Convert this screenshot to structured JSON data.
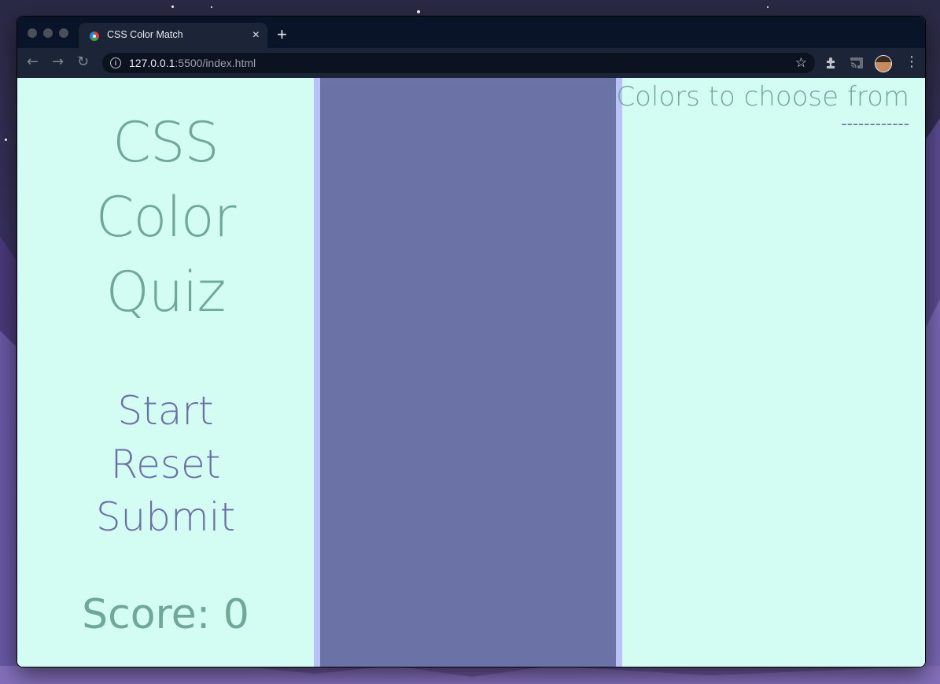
{
  "browser": {
    "tab_title": "CSS Color Match",
    "tab_close": "×",
    "new_tab": "+",
    "url_host": "127.0.0.1",
    "url_rest": ":5500/index.html",
    "back_glyph": "←",
    "forward_glyph": "→",
    "reload_glyph": "↻",
    "bookmark_glyph": "☆",
    "menu_glyph": "⋮",
    "info_glyph": "i",
    "icons": [
      "info-icon",
      "bookmark-star-icon",
      "extensions-puzzle-icon",
      "cast-icon",
      "profile-avatar-icon",
      "more-menu-icon"
    ]
  },
  "app": {
    "title_lines": [
      "CSS",
      "Color",
      "Quiz"
    ],
    "actions": {
      "start": "Start",
      "reset": "Reset",
      "submit": "Submit"
    },
    "score_text": "Score: 0",
    "colors_heading": "Colors to choose from",
    "colors_divider": "------------"
  },
  "colors": {
    "panel_bg": "#d3fdf2",
    "title_green": "#6fa896",
    "action_purple": "#6a70a4",
    "board_border": "#b9c0fc",
    "board_fill": "#6b72a6",
    "chrome_dark": "#0a1428",
    "chrome_toolbar": "#1c2437"
  }
}
